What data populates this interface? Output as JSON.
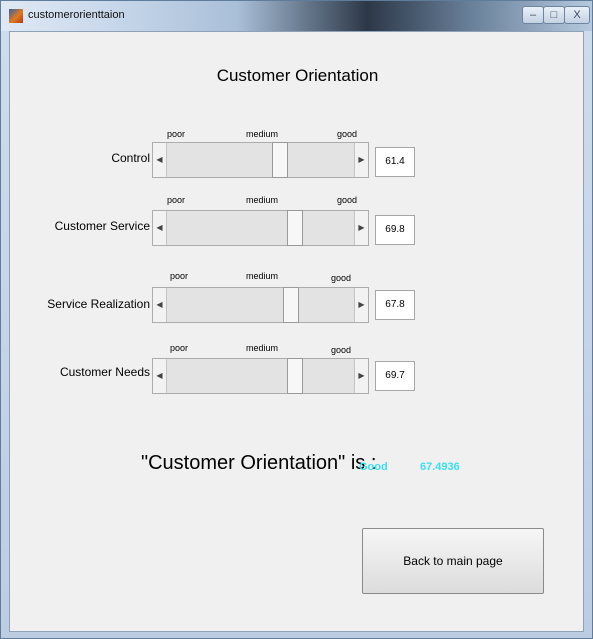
{
  "window": {
    "title": "customerorienttaion",
    "controls": {
      "minimize": "–",
      "maximize": "□",
      "close": "X"
    }
  },
  "heading": "Customer Orientation",
  "scale_labels": {
    "poor": "poor",
    "medium": "medium",
    "good": "good"
  },
  "rows": [
    {
      "label": "Control",
      "value": "61.4",
      "slider_level": 61.4
    },
    {
      "label": "Customer Service",
      "value": "69.8",
      "slider_level": 69.8
    },
    {
      "label": "Service Realization",
      "value": "67.8",
      "slider_level": 67.8
    },
    {
      "label": "Customer Needs",
      "value": "69.7",
      "slider_level": 69.7
    }
  ],
  "slider_range": [
    0,
    100
  ],
  "arrows": {
    "left": "◀",
    "right": "▶"
  },
  "result": {
    "label": "\"Customer Orientation\" is :",
    "status": "Good",
    "score": "67.4936",
    "accent_color": "#39e0ef"
  },
  "buttons": {
    "back_label": "Back to main page"
  }
}
